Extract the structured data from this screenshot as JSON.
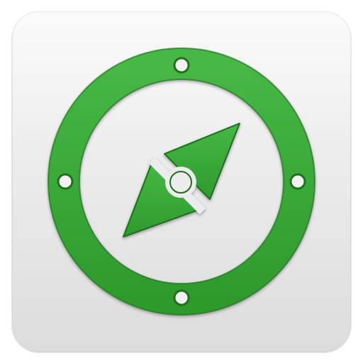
{
  "app_icon": {
    "name": "compass-app-icon",
    "icon": "compass-icon",
    "colors": {
      "accent": "#3aa538",
      "accent_dark": "#1f6f1e",
      "tile_top": "#f4f4f4",
      "tile_bottom": "#dcdcdc",
      "hole_fill": "#f2f2f2"
    }
  }
}
